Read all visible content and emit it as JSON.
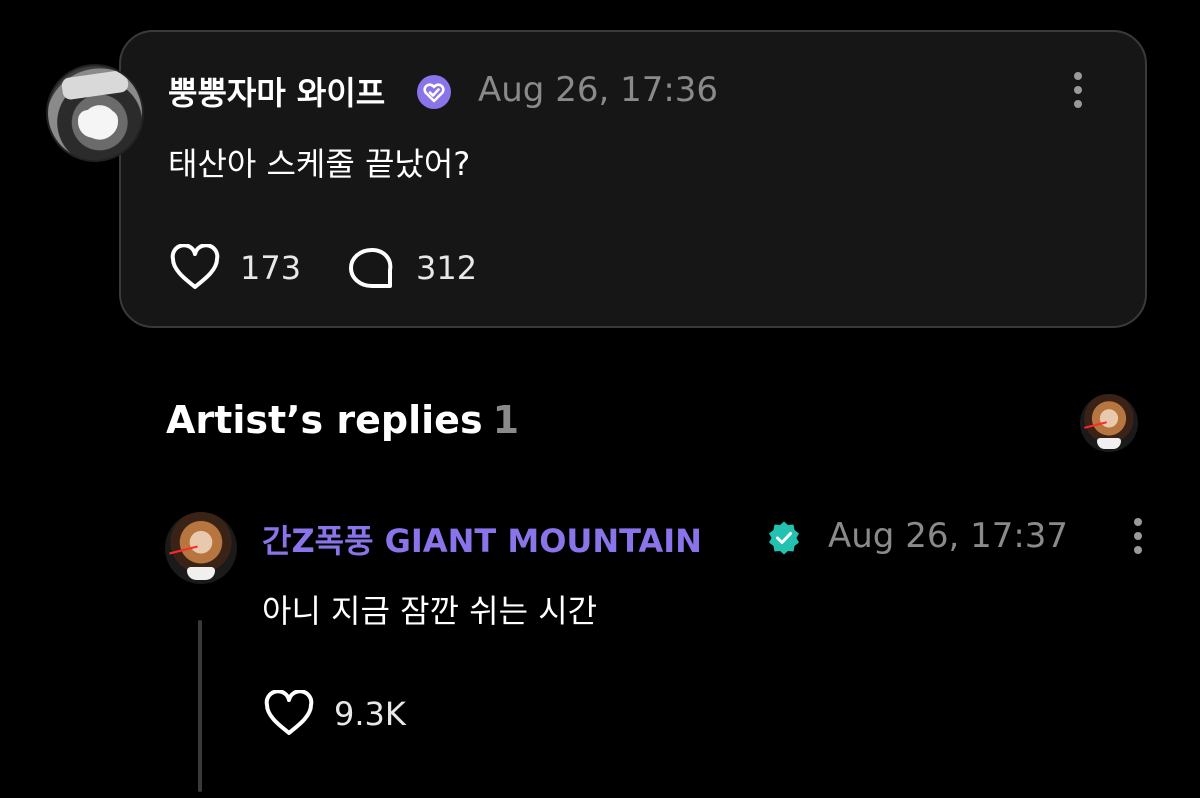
{
  "post": {
    "author": "뿡뿡자마 와이프",
    "timestamp": "Aug 26, 17:36",
    "text": "태산아 스케줄 끝났어?",
    "likes": "173",
    "comments": "312",
    "avatar_icon": "user-avatar",
    "verified_icon": "verified-badge-icon",
    "verified_color": "#8b73ea"
  },
  "artist_replies": {
    "title": "Artist’s replies",
    "count": "1"
  },
  "reply": {
    "author": "간Z폭풍 GIANT MOUNTAIN",
    "timestamp": "Aug 26, 17:37",
    "text": "아니 지금 잠깐 쉬는 시간",
    "likes": "9.3K",
    "author_color": "#8b73ea",
    "verified_color": "#22c1b0"
  },
  "colors": {
    "background": "#000000",
    "card_background": "#161616",
    "card_border": "#3a3a3a",
    "muted_text": "#8a8a8a"
  }
}
